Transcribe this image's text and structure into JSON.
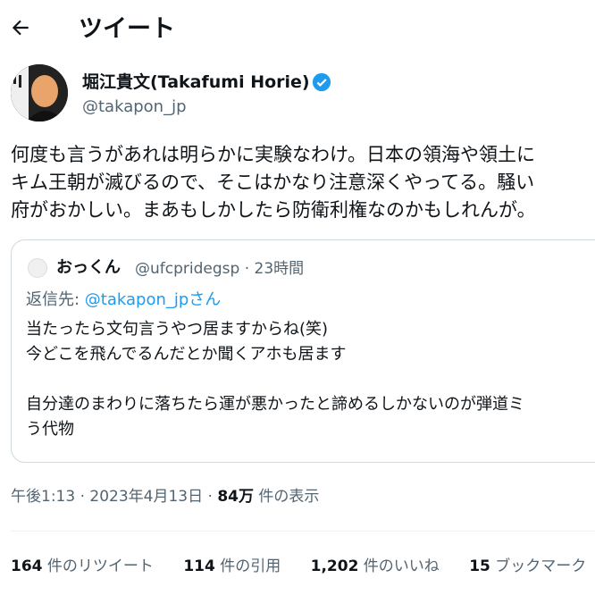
{
  "header": {
    "back_icon": "arrow-left-icon",
    "title": "ツイート"
  },
  "author": {
    "name": "堀江貴文(Takafumi Horie)",
    "handle": "@takapon_jp",
    "verified_color": "#1d9bf0"
  },
  "tweet": {
    "lines": [
      "何度も言うがあれは明らかに実験なわけ。日本の領海や領土に",
      "キム王朝が滅びるので、そこはかなり注意深くやってる。騒い",
      "府がおかしい。まあもしかしたら防衛利権なのかもしれんが。"
    ]
  },
  "quote": {
    "name": "おっくん",
    "handle_time": "@ufcpridegsp · 23時間",
    "reply_prefix": "返信先: ",
    "reply_handle": "@takapon_jp",
    "reply_suffix": "さん",
    "lines": [
      "当たったら文句言うやつ居ますからね(笑)",
      "今どこを飛んでるんだとか聞くアホも居ます",
      "",
      "自分達のまわりに落ちたら運が悪かったと諦めるしかないのが弾道ミ",
      "う代物"
    ]
  },
  "meta": {
    "time": "午後1:13 · 2023年4月13日 · ",
    "views_count": "84万",
    "views_label": " 件の表示"
  },
  "stats": {
    "retweets_count": "164",
    "retweets_label": " 件のリツイート",
    "quotes_count": "114",
    "quotes_label": " 件の引用",
    "likes_count": "1,202",
    "likes_label": " 件のいいね",
    "bookmarks_count": "15",
    "bookmarks_label": " ブックマーク"
  },
  "colors": {
    "text": "#0f1419",
    "secondary": "#536471",
    "link": "#1d9bf0",
    "border": "#cfd9de"
  }
}
